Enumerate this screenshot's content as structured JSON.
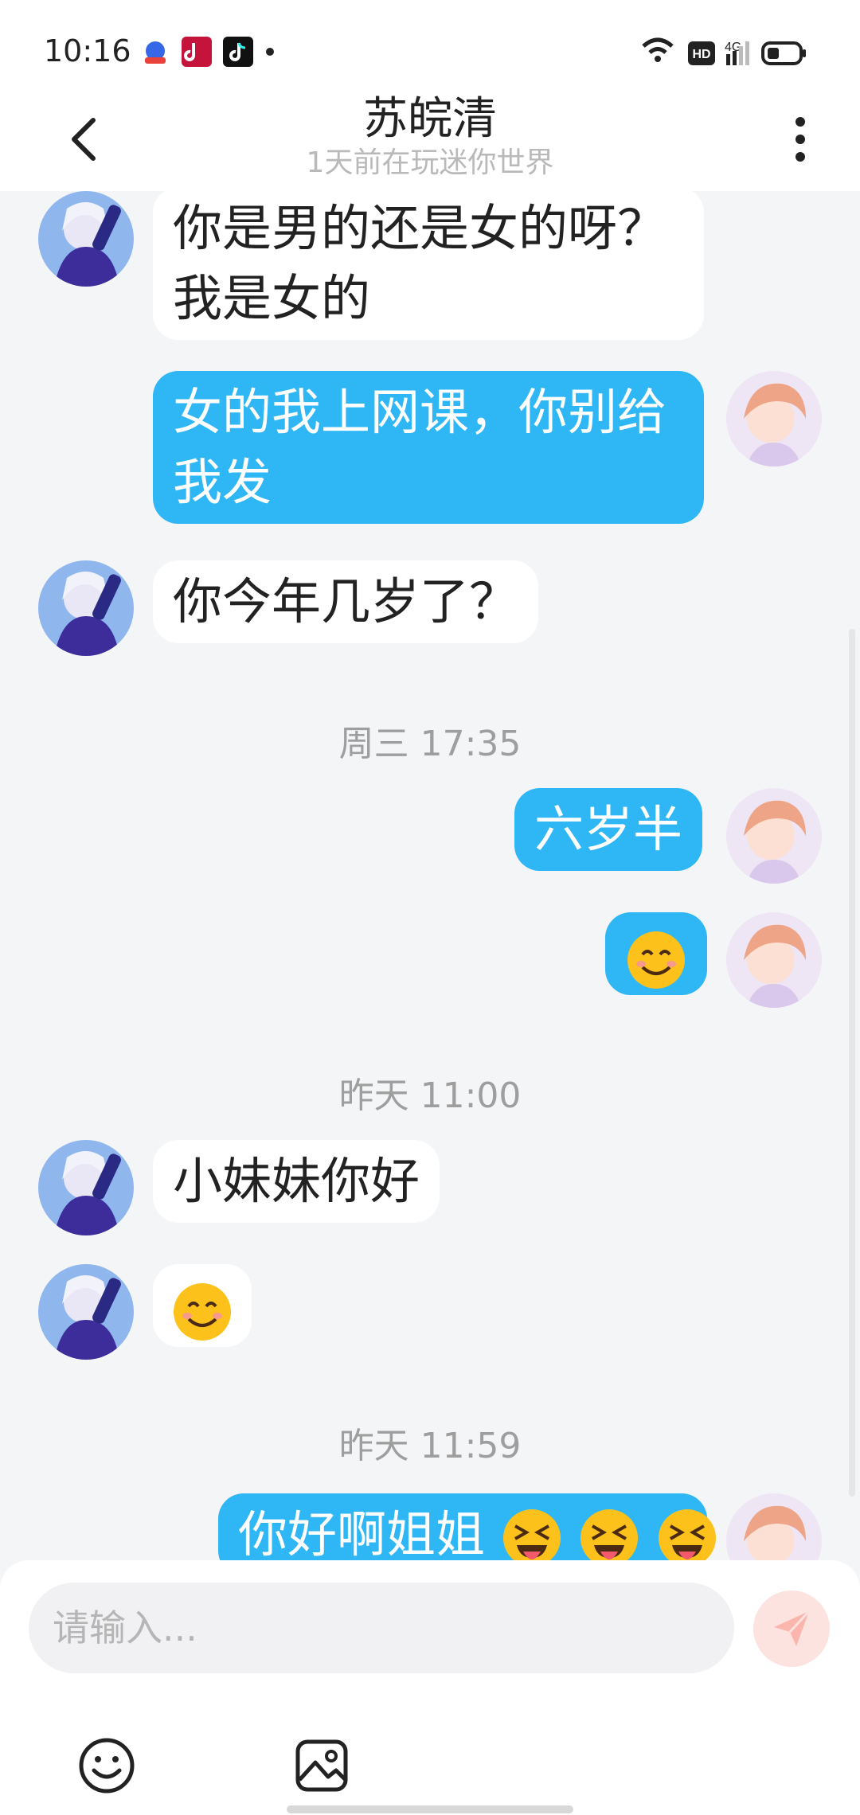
{
  "status_bar": {
    "time": "10:16",
    "network": "4G",
    "hd_label": "HD"
  },
  "header": {
    "title": "苏皖清",
    "subtitle": "1天前在玩迷你世界"
  },
  "messages": {
    "m1": {
      "sender": "other",
      "text": "你是男的还是女的呀？我是女的"
    },
    "m2": {
      "sender": "me",
      "text": "女的我上网课，你别给我发"
    },
    "m3": {
      "sender": "other",
      "text": "你今年几岁了？"
    },
    "t1": "周三 17:35",
    "m4": {
      "sender": "me",
      "text": "六岁半"
    },
    "m5": {
      "sender": "me",
      "emoji": "smiling-face"
    },
    "t2": "昨天 11:00",
    "m6": {
      "sender": "other",
      "text": "小妹妹你好"
    },
    "m7": {
      "sender": "other",
      "emoji": "smiling-face"
    },
    "t3": "昨天 11:59",
    "m8": {
      "sender": "me",
      "text": "你好啊姐姐",
      "emoji": "squinting-tongue-face",
      "emoji_count": 3
    }
  },
  "composer": {
    "placeholder": "请输入..."
  },
  "colors": {
    "my_bubble": "#2fb6f5",
    "their_bubble": "#ffffff",
    "background": "#f4f5f7",
    "send_button": "#fde3e0"
  }
}
